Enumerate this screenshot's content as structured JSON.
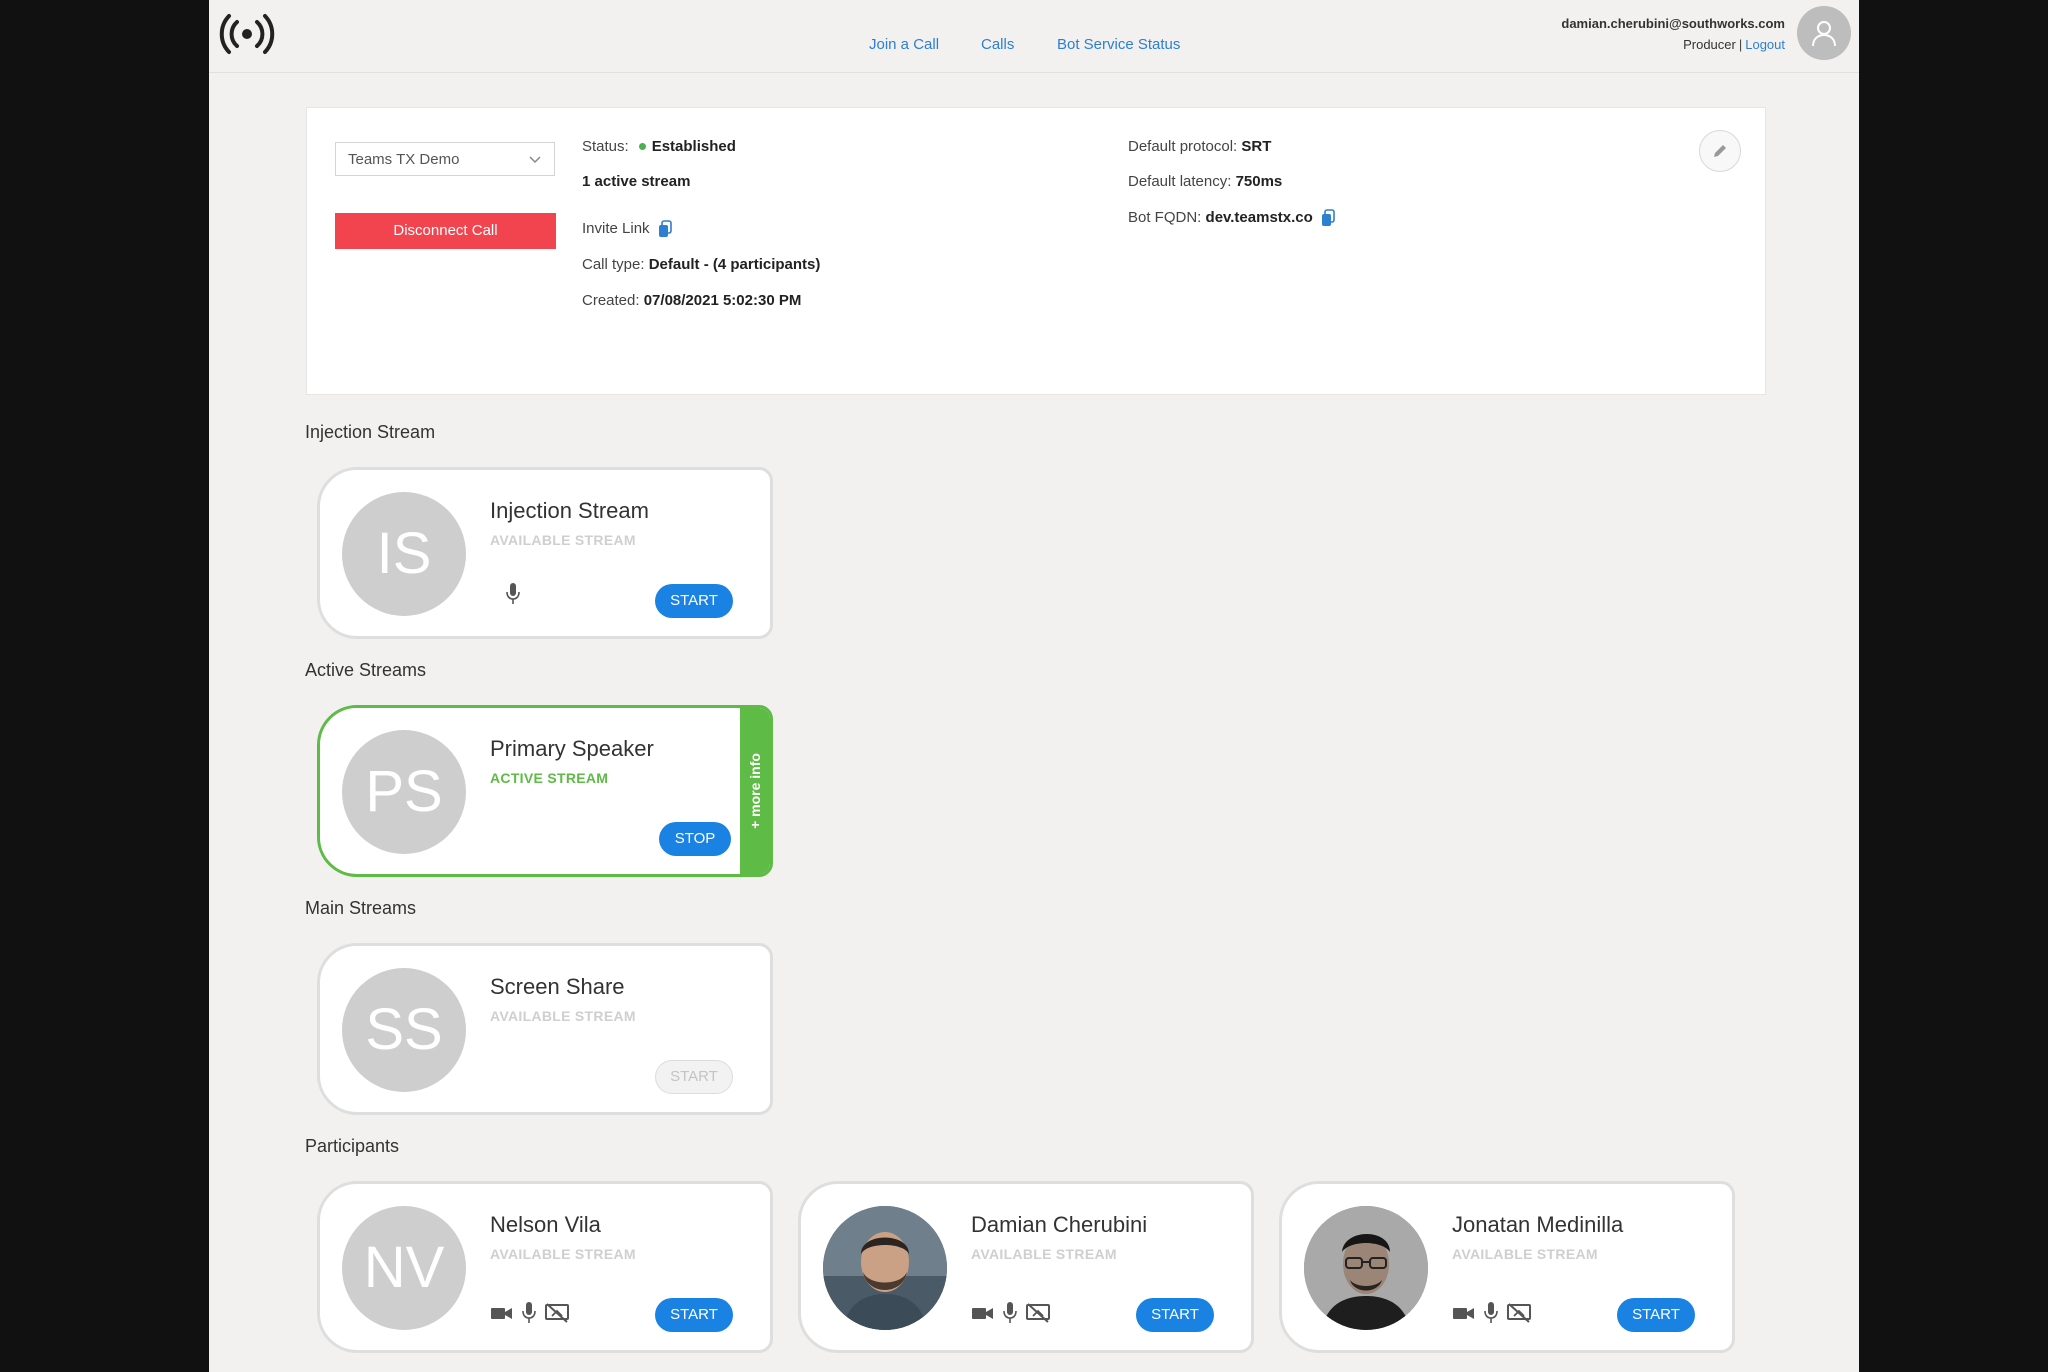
{
  "header": {
    "nav": [
      "Join a Call",
      "Calls",
      "Bot Service Status"
    ],
    "user_email": "damian.cherubini@southworks.com",
    "user_role": "Producer",
    "logout": "Logout",
    "logo_icon": "broadcast-icon",
    "avatar_icon": "user-icon"
  },
  "call": {
    "selected": "Teams TX Demo",
    "disconnect": "Disconnect Call",
    "status_label": "Status:",
    "status_value": "Established",
    "active_streams": "1 active stream",
    "invite_link": "Invite Link",
    "call_type_label": "Call type:",
    "call_type_value": "Default - (4 participants)",
    "created_label": "Created:",
    "created_value": "07/08/2021 5:02:30 PM",
    "protocol_label": "Default protocol:",
    "protocol_value": "SRT",
    "latency_label": "Default latency:",
    "latency_value": "750ms",
    "fqdn_label": "Bot FQDN:",
    "fqdn_value": "dev.teamstx.co"
  },
  "sections": {
    "injection": "Injection Stream",
    "active": "Active Streams",
    "main": "Main Streams",
    "participants": "Participants"
  },
  "injection_card": {
    "initials": "IS",
    "name": "Injection Stream",
    "status": "AVAILABLE STREAM",
    "button": "START"
  },
  "active_card": {
    "initials": "PS",
    "name": "Primary Speaker",
    "status": "ACTIVE STREAM",
    "button": "STOP",
    "more_info": "+ more info"
  },
  "main_card": {
    "initials": "SS",
    "name": "Screen Share",
    "status": "AVAILABLE STREAM",
    "button": "START"
  },
  "participants": [
    {
      "initials": "NV",
      "name": "Nelson Vila",
      "status": "AVAILABLE STREAM",
      "button": "START"
    },
    {
      "initials": "",
      "name": "Damian Cherubini",
      "status": "AVAILABLE STREAM",
      "button": "START"
    },
    {
      "initials": "",
      "name": "Jonatan Medinilla",
      "status": "AVAILABLE STREAM",
      "button": "START"
    }
  ],
  "colors": {
    "accent": "#1a82e2",
    "link": "#2d7fd2",
    "danger": "#f2444e",
    "active": "#5dbb46"
  }
}
